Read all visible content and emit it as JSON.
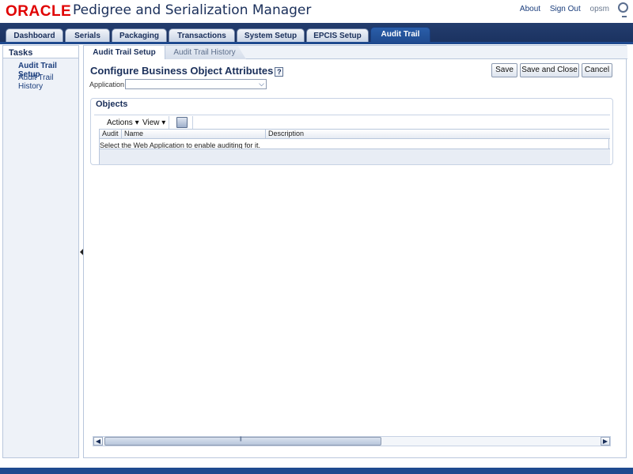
{
  "header": {
    "logo": "ORACLE",
    "app_title": "Pedigree and Serialization Manager",
    "links": {
      "about": "About",
      "sign_out": "Sign Out",
      "user": "opsm"
    }
  },
  "main_tabs": [
    {
      "label": "Dashboard"
    },
    {
      "label": "Serials"
    },
    {
      "label": "Packaging"
    },
    {
      "label": "Transactions"
    },
    {
      "label": "System Setup"
    },
    {
      "label": "EPCIS Setup"
    },
    {
      "label": "Audit Trail",
      "active": true
    }
  ],
  "sidebar": {
    "title": "Tasks",
    "items": [
      {
        "label": "Audit Trail Setup",
        "selected": true
      },
      {
        "label": "Audit Trail History"
      }
    ]
  },
  "sub_tabs": [
    {
      "label": "Audit Trail Setup",
      "active": true
    },
    {
      "label": "Audit Trail History"
    }
  ],
  "page": {
    "title": "Configure Business Object Attributes",
    "help": "?",
    "buttons": {
      "save": "Save",
      "save_close": "Save and Close",
      "cancel": "Cancel"
    },
    "application_label": "Application",
    "application_value": ""
  },
  "objects": {
    "title": "Objects",
    "toolbar": {
      "actions": "Actions",
      "view": "View"
    },
    "columns": [
      "Audit",
      "Name",
      "Description"
    ],
    "empty_message": "Select the Web Application to enable auditing for it."
  },
  "colors": {
    "accent": "#1f4a8f",
    "brand_red": "#e00000",
    "header_navy": "#1b3260"
  }
}
